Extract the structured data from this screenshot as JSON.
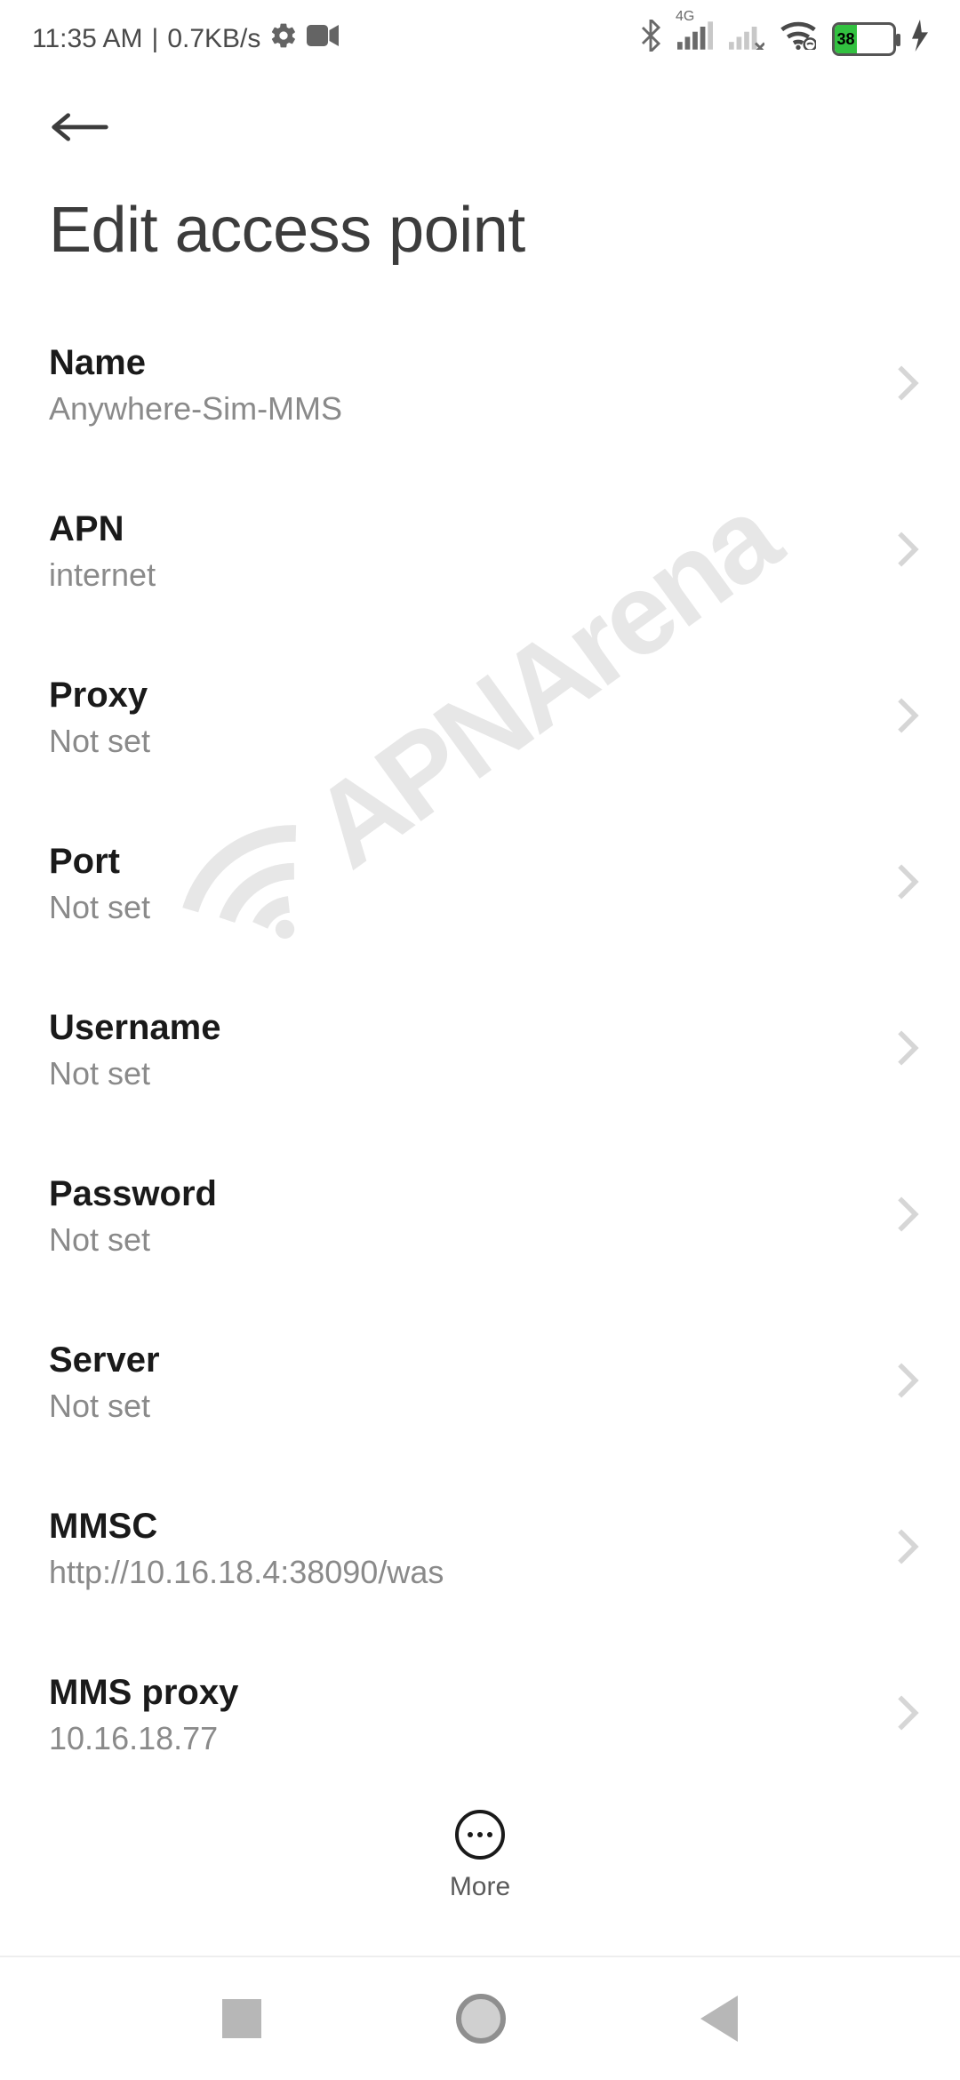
{
  "status": {
    "time": "11:35 AM",
    "speed": "0.7KB/s",
    "network_badge": "4G",
    "battery_pct": "38"
  },
  "page": {
    "title": "Edit access point"
  },
  "rows": [
    {
      "label": "Name",
      "value": "Anywhere-Sim-MMS"
    },
    {
      "label": "APN",
      "value": "internet"
    },
    {
      "label": "Proxy",
      "value": "Not set"
    },
    {
      "label": "Port",
      "value": "Not set"
    },
    {
      "label": "Username",
      "value": "Not set"
    },
    {
      "label": "Password",
      "value": "Not set"
    },
    {
      "label": "Server",
      "value": "Not set"
    },
    {
      "label": "MMSC",
      "value": "http://10.16.18.4:38090/was"
    },
    {
      "label": "MMS proxy",
      "value": "10.16.18.77"
    }
  ],
  "more": {
    "label": "More"
  },
  "watermark": {
    "text": "APNArena"
  }
}
